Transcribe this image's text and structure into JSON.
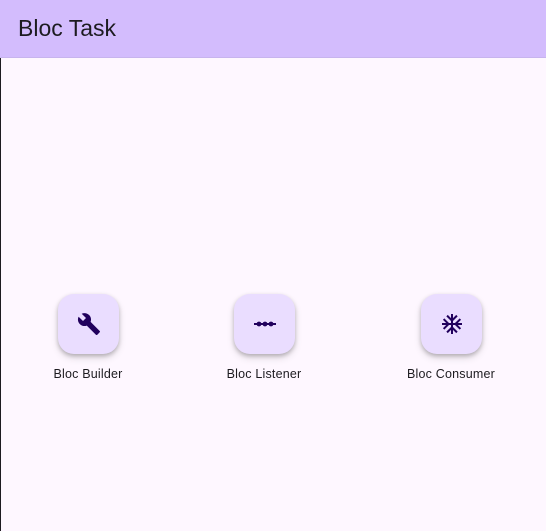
{
  "app_bar": {
    "title": "Bloc Task"
  },
  "actions": [
    {
      "label": "Bloc Builder",
      "icon": "wrench-icon"
    },
    {
      "label": "Bloc Listener",
      "icon": "commit-icon"
    },
    {
      "label": "Bloc Consumer",
      "icon": "snowflake-icon"
    }
  ],
  "colors": {
    "app_bar": "#d3bcfd",
    "background": "#fef7ff",
    "button": "#eaddff",
    "icon": "#21005d",
    "text": "#1d1b20"
  }
}
